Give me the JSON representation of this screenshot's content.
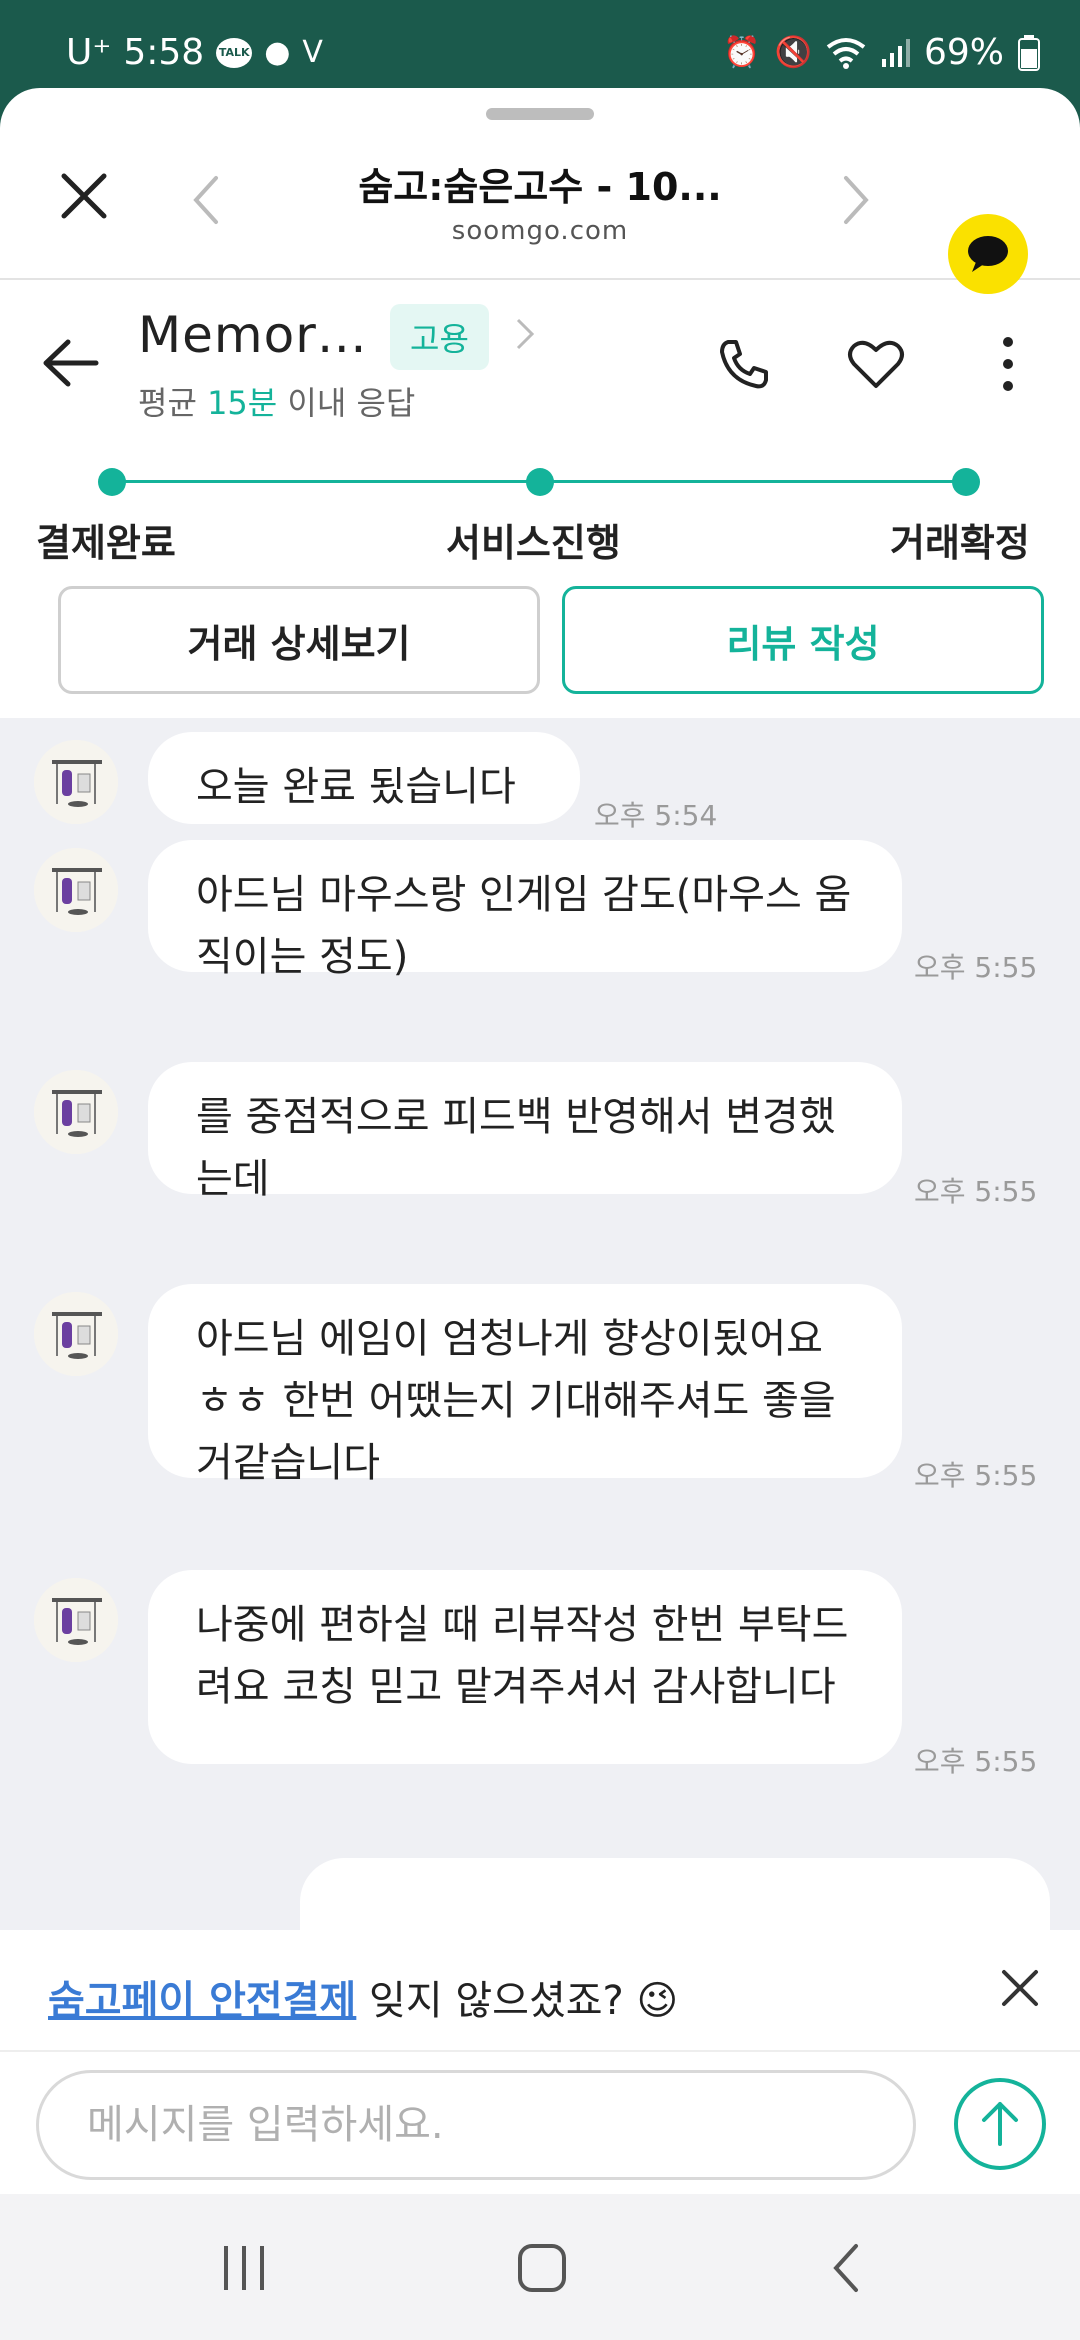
{
  "status_bar": {
    "carrier": "U⁺",
    "time": "5:58",
    "talk_icon_label": "TALK",
    "battery": "69%"
  },
  "browser_bar": {
    "title": "숨고:숨은고수 - 10...",
    "url": "soomgo.com"
  },
  "header": {
    "name": "Memor…",
    "badge": "고용",
    "response_prefix": "평균 ",
    "response_time": "15분",
    "response_suffix": " 이내 응답"
  },
  "progress": {
    "steps": [
      "결제완료",
      "서비스진행",
      "거래확정"
    ]
  },
  "actions": {
    "detail": "거래 상세보기",
    "review": "리뷰 작성"
  },
  "messages": [
    {
      "text": "오늘 완료 됬습니다",
      "time": "오후 5:54"
    },
    {
      "text": "아드님 마우스랑 인게임 감도(마우스 움직이는 정도)",
      "time": "오후 5:55"
    },
    {
      "text": "를 중점적으로 피드백 반영해서 변경했는데",
      "time": "오후 5:55"
    },
    {
      "text": "아드님 에임이 엄청나게 향상이됬어요 ㅎㅎ 한번 어땠는지 기대해주셔도 좋을거같습니다",
      "time": "오후 5:55"
    },
    {
      "text": "나중에 편하실 때 리뷰작성 한번 부탁드려요 코칭 믿고 맡겨주셔서 감사합니다",
      "time": "오후 5:55"
    }
  ],
  "banner": {
    "link": "숨고페이 안전결제",
    "text": " 잊지 않으셨죠? 😉"
  },
  "input": {
    "placeholder": "메시지를 입력하세요."
  },
  "colors": {
    "accent": "#14b39a",
    "status_bar": "#1b5a4c",
    "kakao": "#fae100"
  }
}
